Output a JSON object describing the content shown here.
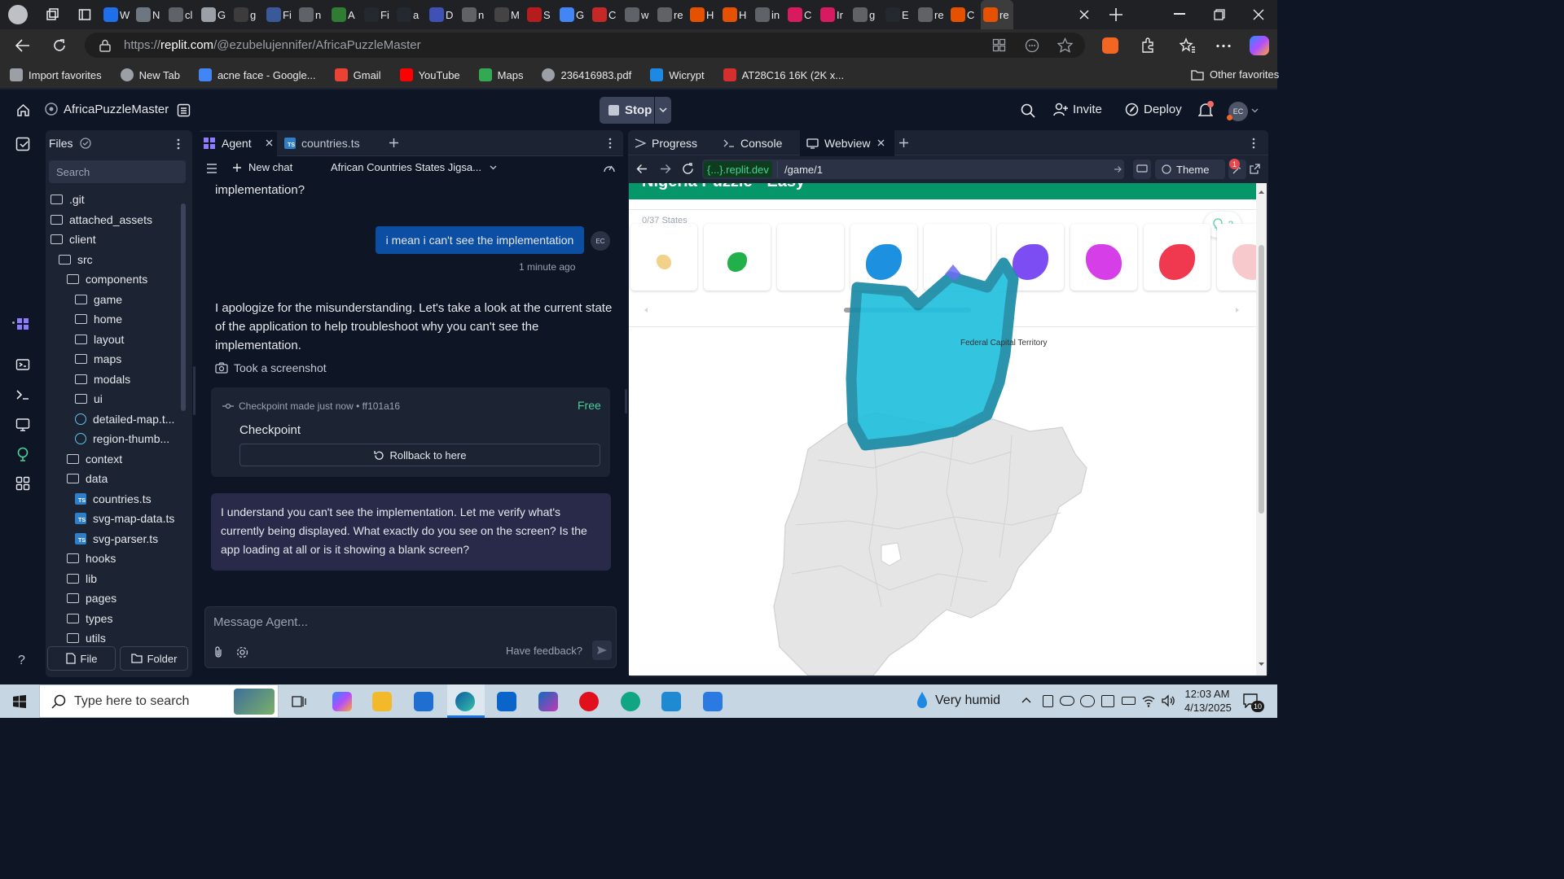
{
  "browser": {
    "url_prefix": "https://",
    "url_host": "replit.com",
    "url_path": "/@ezubelujennifer/AfricaPuzzleMaster",
    "tabs": [
      {
        "label": "W",
        "color": "#1f6feb"
      },
      {
        "label": "N",
        "color": "#6e7681"
      },
      {
        "label": "cl",
        "color": "#5f6368"
      },
      {
        "label": "G",
        "color": "#9aa0a6"
      },
      {
        "label": "g",
        "color": "#3c3c3c"
      },
      {
        "label": "Fi",
        "color": "#3b5998"
      },
      {
        "label": "n",
        "color": "#5f6368"
      },
      {
        "label": "A",
        "color": "#2e7d32"
      },
      {
        "label": "Fi",
        "color": "#24292f"
      },
      {
        "label": "a",
        "color": "#24292f"
      },
      {
        "label": "D",
        "color": "#3f51b5"
      },
      {
        "label": "n",
        "color": "#5f6368"
      },
      {
        "label": "M",
        "color": "#444"
      },
      {
        "label": "S",
        "color": "#b71c1c"
      },
      {
        "label": "G",
        "color": "#4285f4"
      },
      {
        "label": "C",
        "color": "#c62828"
      },
      {
        "label": "w",
        "color": "#5f6368"
      },
      {
        "label": "re",
        "color": "#5f6368"
      },
      {
        "label": "H",
        "color": "#e65100"
      },
      {
        "label": "H",
        "color": "#e65100"
      },
      {
        "label": "in",
        "color": "#5f6368"
      },
      {
        "label": "C",
        "color": "#d81b60"
      },
      {
        "label": "Ir",
        "color": "#d81b60"
      },
      {
        "label": "g",
        "color": "#5f6368"
      },
      {
        "label": "E",
        "color": "#24292f"
      },
      {
        "label": "re",
        "color": "#5f6368"
      },
      {
        "label": "C",
        "color": "#e65100"
      },
      {
        "label": "re A",
        "color": "#e65100"
      }
    ],
    "bookmarks": [
      {
        "label": "Import favorites",
        "color": "#9aa0a6"
      },
      {
        "label": "New Tab",
        "color": "#9aa0a6"
      },
      {
        "label": "acne face - Google...",
        "color": "#4285f4"
      },
      {
        "label": "Gmail",
        "color": "#ea4335"
      },
      {
        "label": "YouTube",
        "color": "#ff0000"
      },
      {
        "label": "Maps",
        "color": "#34a853"
      },
      {
        "label": "236416983.pdf",
        "color": "#9aa0a6"
      },
      {
        "label": "Wicrypt",
        "color": "#1e88e5"
      },
      {
        "label": "AT28C16 16K (2K x...",
        "color": "#d32f2f"
      }
    ],
    "other_favorites": "Other favorites"
  },
  "header": {
    "project": "AfricaPuzzleMaster",
    "stop_label": "Stop",
    "invite_label": "Invite",
    "deploy_label": "Deploy",
    "avatar_initials": "EC"
  },
  "files": {
    "title": "Files",
    "search_placeholder": "Search",
    "tree": [
      {
        "name": ".git",
        "type": "folder",
        "depth": 0
      },
      {
        "name": "attached_assets",
        "type": "folder",
        "depth": 0
      },
      {
        "name": "client",
        "type": "folder-open",
        "depth": 0
      },
      {
        "name": "src",
        "type": "folder-open",
        "depth": 1
      },
      {
        "name": "components",
        "type": "folder-open",
        "depth": 2
      },
      {
        "name": "game",
        "type": "folder",
        "depth": 3
      },
      {
        "name": "home",
        "type": "folder",
        "depth": 3
      },
      {
        "name": "layout",
        "type": "folder",
        "depth": 3
      },
      {
        "name": "maps",
        "type": "folder",
        "depth": 3
      },
      {
        "name": "modals",
        "type": "folder",
        "depth": 3
      },
      {
        "name": "ui",
        "type": "folder",
        "depth": 3
      },
      {
        "name": "detailed-map.t...",
        "type": "react",
        "depth": 3
      },
      {
        "name": "region-thumb...",
        "type": "react",
        "depth": 3
      },
      {
        "name": "context",
        "type": "folder",
        "depth": 2
      },
      {
        "name": "data",
        "type": "folder-open",
        "depth": 2
      },
      {
        "name": "countries.ts",
        "type": "ts",
        "depth": 3
      },
      {
        "name": "svg-map-data.ts",
        "type": "ts",
        "depth": 3
      },
      {
        "name": "svg-parser.ts",
        "type": "ts",
        "depth": 3
      },
      {
        "name": "hooks",
        "type": "folder",
        "depth": 2
      },
      {
        "name": "lib",
        "type": "folder",
        "depth": 2
      },
      {
        "name": "pages",
        "type": "folder",
        "depth": 2
      },
      {
        "name": "types",
        "type": "folder",
        "depth": 2
      },
      {
        "name": "utils",
        "type": "folder",
        "depth": 2
      }
    ],
    "new_file": "File",
    "new_folder": "Folder"
  },
  "agent": {
    "tab_agent": "Agent",
    "tab_file": "countries.ts",
    "new_chat": "New chat",
    "chat_title": "African Countries States Jigsa...",
    "prev_tail": "implementation?",
    "user_msg": "i mean i can't see the implementation",
    "user_initials": "EC",
    "user_time": "1 minute ago",
    "reply_line1": "I apologize for the misunderstanding. Let's take a look at the current state",
    "reply_line2": "of the application to help troubleshoot why you can't see the",
    "reply_line3": "implementation.",
    "screenshot_label": "Took a screenshot",
    "checkpoint_meta": "Checkpoint made just now • ff101a16",
    "checkpoint_free": "Free",
    "checkpoint_title": "Checkpoint",
    "rollback_label": "Rollback to here",
    "final_line1": "I understand you can't see the implementation. Let me verify what's",
    "final_line2": "currently being displayed. What exactly do you see on the screen? Is the",
    "final_line3": "app loading at all or is it showing a blank screen?",
    "input_placeholder": "Message Agent...",
    "feedback": "Have feedback?"
  },
  "webview": {
    "tab_progress": "Progress",
    "tab_console": "Console",
    "tab_webview": "Webview",
    "domain": "{...}.replit.dev",
    "path": "/game/1",
    "theme_label": "Theme",
    "badge_count": "1",
    "game_title": "Nigeria Puzzle - Easy",
    "states_counter": "0/37 States",
    "hint_count": "3",
    "region_label": "Federal Capital Territory",
    "pieces": [
      {
        "color": "#f2d28a"
      },
      {
        "color": "#22b04b"
      },
      {
        "color": "#ffffff"
      },
      {
        "color": "#1e90e0"
      },
      {
        "color": "#ffffff"
      },
      {
        "color": "#7b4df2"
      },
      {
        "color": "#d63ee8"
      },
      {
        "color": "#f0384f"
      },
      {
        "color": "#f7c9cd"
      }
    ]
  },
  "taskbar": {
    "search_placeholder": "Type here to search",
    "weather": "Very humid",
    "time": "12:03 AM",
    "date": "4/13/2025",
    "notif_count": "10"
  }
}
